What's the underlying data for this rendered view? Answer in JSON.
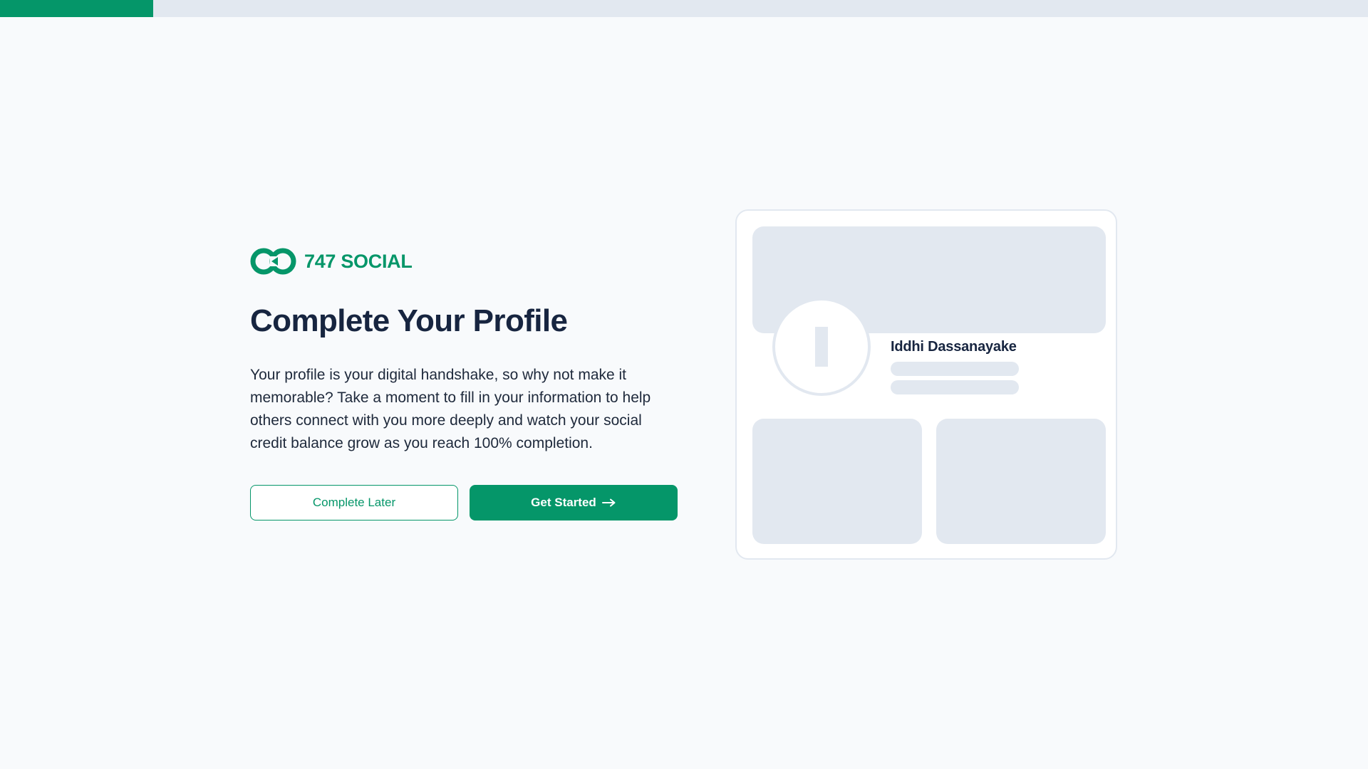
{
  "progress": {
    "fraction": 0.112,
    "track_color": "#e2e8f0",
    "fill_color": "#059669"
  },
  "brand": {
    "name": "747 SOCIAL",
    "logo_icon": "infinity-play-logo-icon",
    "accent_color": "#059669"
  },
  "onboarding": {
    "title": "Complete Your Profile",
    "description": "Your profile is your digital handshake, so why not make it memorable? Take a moment to fill in your information to help others connect with you more deeply and watch your social credit balance grow as you reach 100% completion."
  },
  "actions": {
    "later_label": "Complete Later",
    "start_label": "Get Started",
    "start_icon": "arrow-right-icon"
  },
  "preview_card": {
    "name": "Iddhi Dassanayake",
    "avatar_initial_icon": "letter-i-placeholder-icon"
  }
}
